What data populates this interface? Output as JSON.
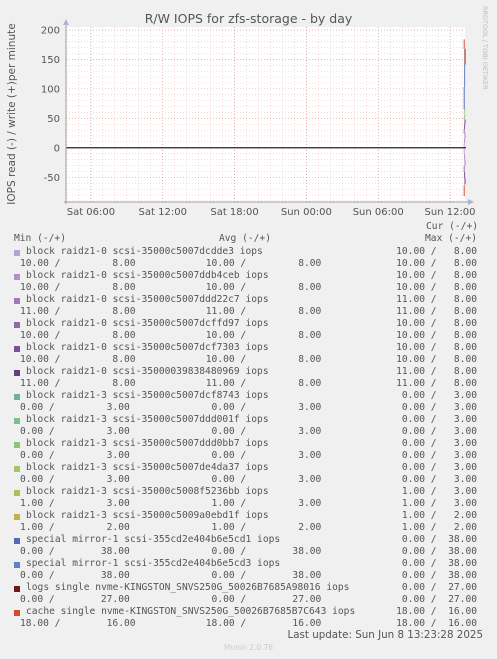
{
  "chart_data": {
    "type": "line",
    "title": "R/W IOPS for zfs-storage - by day",
    "ylabel": "IOPS read (-) / write (+)per minute",
    "ylim": [
      -92,
      205
    ],
    "yticks": [
      200,
      150,
      100,
      50,
      0,
      -50
    ],
    "ytick_labels": [
      "200",
      "150",
      "100",
      "50",
      "0",
      "-50"
    ],
    "xticks": [
      "Sat 06:00",
      "Sat 12:00",
      "Sat 18:00",
      "Sun 00:00",
      "Sun 06:00",
      "Sun 12:00"
    ],
    "xlim": [
      "Sat 03:55",
      "Sun 13:15"
    ],
    "grid": true,
    "series": [
      {
        "name": "block raidz1-0 scsi-35000c5007dcdde3 iops",
        "color": "#b8a1d4",
        "cur_read": "10.00",
        "cur_write": "8.00",
        "min_read": "10.00",
        "min_write": "8.00",
        "avg_read": "10.00",
        "avg_write": "8.00",
        "max_read": "10.00",
        "max_write": "8.00"
      },
      {
        "name": "block raidz1-0 scsi-35000c5007ddb4ceb iops",
        "color": "#b58dc8",
        "cur_read": "10.00",
        "cur_write": "8.00",
        "min_read": "10.00",
        "min_write": "8.00",
        "avg_read": "10.00",
        "avg_write": "8.00",
        "max_read": "10.00",
        "max_write": "8.00"
      },
      {
        "name": "block raidz1-0 scsi-35000c5007ddd22c7 iops",
        "color": "#a47ab6",
        "cur_read": "11.00",
        "cur_write": "8.00",
        "min_read": "11.00",
        "min_write": "8.00",
        "avg_read": "11.00",
        "avg_write": "8.00",
        "max_read": "11.00",
        "max_write": "8.00"
      },
      {
        "name": "block raidz1-0 scsi-35000c5007dcffd97 iops",
        "color": "#9468a8",
        "cur_read": "10.00",
        "cur_write": "8.00",
        "min_read": "10.00",
        "min_write": "8.00",
        "avg_read": "10.00",
        "avg_write": "8.00",
        "max_read": "10.00",
        "max_write": "8.00"
      },
      {
        "name": "block raidz1-0 scsi-35000c5007dcf7303 iops",
        "color": "#7d4f96",
        "cur_read": "10.00",
        "cur_write": "8.00",
        "min_read": "10.00",
        "min_write": "8.00",
        "avg_read": "10.00",
        "avg_write": "8.00",
        "max_read": "10.00",
        "max_write": "8.00"
      },
      {
        "name": "block raidz1-0 scsi-35000039838480969 iops",
        "color": "#6a3c84",
        "cur_read": "11.00",
        "cur_write": "8.00",
        "min_read": "11.00",
        "min_write": "8.00",
        "avg_read": "11.00",
        "avg_write": "8.00",
        "max_read": "11.00",
        "max_write": "8.00"
      },
      {
        "name": "block raidz1-3 scsi-35000c5007dcf8743 iops",
        "color": "#6cb39a",
        "cur_read": "0.00",
        "cur_write": "3.00",
        "min_read": "0.00",
        "min_write": "3.00",
        "avg_read": "0.00",
        "avg_write": "3.00",
        "max_read": "0.00",
        "max_write": "3.00"
      },
      {
        "name": "block raidz1-3 scsi-35000c5007ddd001f iops",
        "color": "#7cbf8a",
        "cur_read": "0.00",
        "cur_write": "3.00",
        "min_read": "0.00",
        "min_write": "3.00",
        "avg_read": "0.00",
        "avg_write": "3.00",
        "max_read": "0.00",
        "max_write": "3.00"
      },
      {
        "name": "block raidz1-3 scsi-35000c5007ddd0bb7 iops",
        "color": "#8cc47a",
        "cur_read": "0.00",
        "cur_write": "3.00",
        "min_read": "0.00",
        "min_write": "3.00",
        "avg_read": "0.00",
        "avg_write": "3.00",
        "max_read": "0.00",
        "max_write": "3.00"
      },
      {
        "name": "block raidz1-3 scsi-35000c5007de4da37 iops",
        "color": "#a4c46a",
        "cur_read": "0.00",
        "cur_write": "3.00",
        "min_read": "0.00",
        "min_write": "3.00",
        "avg_read": "0.00",
        "avg_write": "3.00",
        "max_read": "0.00",
        "max_write": "3.00"
      },
      {
        "name": "block raidz1-3 scsi-35000c5008f5236bb iops",
        "color": "#b8bb5a",
        "cur_read": "1.00",
        "cur_write": "3.00",
        "min_read": "1.00",
        "min_write": "3.00",
        "avg_read": "1.00",
        "avg_write": "3.00",
        "max_read": "1.00",
        "max_write": "3.00"
      },
      {
        "name": "block raidz1-3 scsi-35000c5009a0ebd1f iops",
        "color": "#c8b048",
        "cur_read": "1.00",
        "cur_write": "2.00",
        "min_read": "1.00",
        "min_write": "2.00",
        "avg_read": "1.00",
        "avg_write": "2.00",
        "max_read": "1.00",
        "max_write": "2.00"
      },
      {
        "name": "special mirror-1 scsi-355cd2e404b6e5cd1 iops",
        "color": "#5569b5",
        "cur_read": "0.00",
        "cur_write": "38.00",
        "min_read": "0.00",
        "min_write": "38.00",
        "avg_read": "0.00",
        "avg_write": "38.00",
        "max_read": "0.00",
        "max_write": "38.00"
      },
      {
        "name": "special mirror-1 scsi-355cd2e404b6e5cd3 iops",
        "color": "#5e82c8",
        "cur_read": "0.00",
        "cur_write": "38.00",
        "min_read": "0.00",
        "min_write": "38.00",
        "avg_read": "0.00",
        "avg_write": "38.00",
        "max_read": "0.00",
        "max_write": "38.00"
      },
      {
        "name": "logs single nvme-KINGSTON_SNVS250G_50026B7685A98016 iops",
        "color": "#6e1a1a",
        "cur_read": "0.00",
        "cur_write": "27.00",
        "min_read": "0.00",
        "min_write": "27.00",
        "avg_read": "0.00",
        "avg_write": "27.00",
        "max_read": "0.00",
        "max_write": "27.00"
      },
      {
        "name": "cache single nvme-KINGSTON_SNVS250G_50026B7685B7C643 iops",
        "color": "#d8492e",
        "cur_read": "18.00",
        "cur_write": "16.00",
        "min_read": "18.00",
        "min_write": "16.00",
        "avg_read": "18.00",
        "avg_write": "16.00",
        "max_read": "18.00",
        "max_write": "16.00"
      }
    ]
  },
  "legend": {
    "cur_header": "Cur (-/+)",
    "min_header": "Min (-/+)",
    "avg_header": "Avg (-/+)",
    "max_header": "Max (-/+)"
  },
  "side_label": "RRDTOOL / TOBI OETIKER",
  "last_update": "Last update: Sun Jun  8 13:23:28 2025",
  "munin_version": "Munin 2.0.76",
  "colors": {
    "background": "#f0f0f0",
    "plot_background": "#ffffff",
    "grid_minor": "#e8b8b8",
    "grid_major": "#d88888",
    "axis": "#000000",
    "text": "#555555"
  }
}
